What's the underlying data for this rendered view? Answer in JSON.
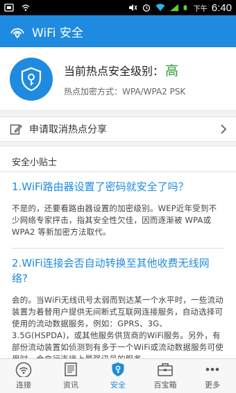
{
  "status_bar": {
    "ampm": "下午",
    "time": "6:40"
  },
  "app_bar": {
    "title": "WiFi 安全"
  },
  "hero": {
    "level_label": "当前热点安全级别：",
    "level_value": "高",
    "encryption": "热点加密方式：WPA/WPA2 PSK"
  },
  "share_row": {
    "label": "申请取消热点分享"
  },
  "tips": {
    "title": "安全小贴士",
    "items": [
      {
        "question": "1.WiFi路由器设置了密码就安全了吗？",
        "answer": "不是的，还要看路由器设置的加密级别。WEP近年受到不少网络专家抨击，指其安全性欠佳，因而逐渐被 WPA或 WPA2 等新加密方法取代。"
      },
      {
        "question": "2.WiFi连接会否自动转换至其他收费无线网络?",
        "answer": "会的。当WiFi无线讯号太弱而到达某一个水平时，一些流动装置为着替用户提供无间断式互联网连接服务，自动选择可使用的流动数据服务，例如：GPRS、3G、3.5G(HSPDA)，或其他服务供货商的WiFi服务。另外，有部份流动装置如侦测到有多于一个WiFi或流动数据服务可使用时，会自行连接上最强讯号的服务。"
      }
    ]
  },
  "bottom_nav": [
    {
      "label": "连接",
      "icon": "wifi-icon"
    },
    {
      "label": "资讯",
      "icon": "news-icon"
    },
    {
      "label": "安全",
      "icon": "shield-icon",
      "active": true
    },
    {
      "label": "百宝箱",
      "icon": "toolbox-icon"
    },
    {
      "label": "更多",
      "icon": "more-icon"
    }
  ],
  "colors": {
    "primary": "#1e8be0",
    "level_high": "#2e9a3a"
  }
}
